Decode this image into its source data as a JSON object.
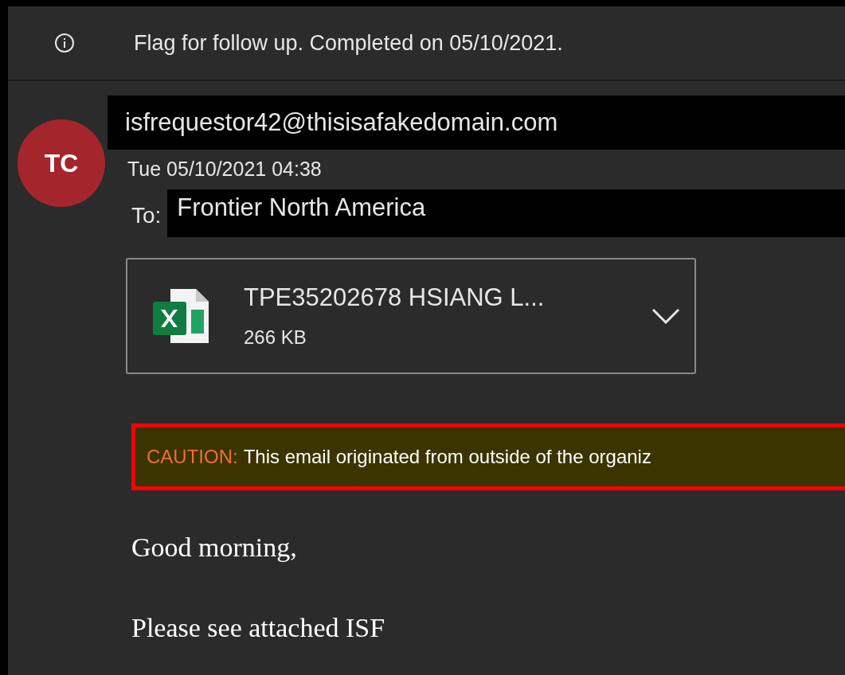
{
  "info_bar": {
    "text": "Flag for follow up. Completed on 05/10/2021."
  },
  "sender": {
    "initials": "TC",
    "email": "isfrequestor42@thisisafakedomain.com",
    "date": "Tue 05/10/2021 04:38"
  },
  "to": {
    "label": "To:",
    "value": "Frontier North America"
  },
  "attachment": {
    "name": "TPE35202678 HSIANG L...",
    "size": "266 KB"
  },
  "caution": {
    "label": "CAUTION:",
    "text": "This email originated from outside of the organiz"
  },
  "body": [
    "Good morning,",
    "Please see attached ISF"
  ]
}
